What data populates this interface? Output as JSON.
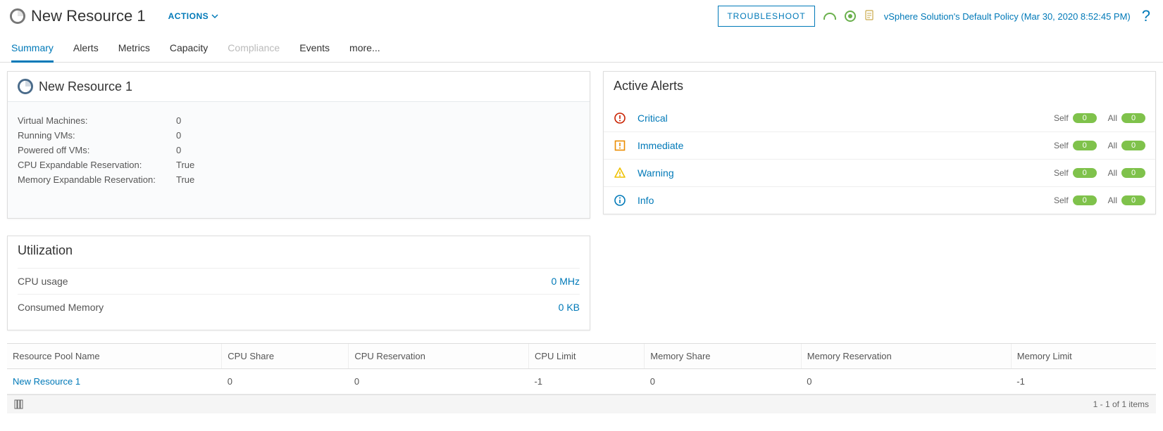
{
  "header": {
    "title": "New Resource 1",
    "actions_label": "ACTIONS",
    "troubleshoot_label": "TROUBLESHOOT",
    "policy_text": "vSphere Solution's Default Policy (Mar 30, 2020 8:52:45 PM)"
  },
  "tabs": [
    {
      "label": "Summary",
      "active": true,
      "disabled": false
    },
    {
      "label": "Alerts",
      "active": false,
      "disabled": false
    },
    {
      "label": "Metrics",
      "active": false,
      "disabled": false
    },
    {
      "label": "Capacity",
      "active": false,
      "disabled": false
    },
    {
      "label": "Compliance",
      "active": false,
      "disabled": true
    },
    {
      "label": "Events",
      "active": false,
      "disabled": false
    },
    {
      "label": "more...",
      "active": false,
      "disabled": false
    }
  ],
  "summary_card": {
    "title": "New Resource 1",
    "rows": [
      {
        "label": "Virtual Machines:",
        "value": "0"
      },
      {
        "label": "Running VMs:",
        "value": "0"
      },
      {
        "label": "Powered off VMs:",
        "value": "0"
      },
      {
        "label": "CPU Expandable Reservation:",
        "value": "True"
      },
      {
        "label": "Memory Expandable Reservation:",
        "value": "True"
      }
    ]
  },
  "utilization": {
    "title": "Utilization",
    "rows": [
      {
        "label": "CPU usage",
        "value": "0 MHz"
      },
      {
        "label": "Consumed Memory",
        "value": "0 KB"
      }
    ]
  },
  "alerts": {
    "title": "Active Alerts",
    "self_label": "Self",
    "all_label": "All",
    "rows": [
      {
        "level": "Critical",
        "self": "0",
        "all": "0",
        "color": "#c92100",
        "shape": "circle-excl"
      },
      {
        "level": "Immediate",
        "self": "0",
        "all": "0",
        "color": "#eb8d00",
        "shape": "square-excl"
      },
      {
        "level": "Warning",
        "self": "0",
        "all": "0",
        "color": "#efc100",
        "shape": "tri-excl"
      },
      {
        "level": "Info",
        "self": "0",
        "all": "0",
        "color": "#0079b8",
        "shape": "circle-i"
      }
    ]
  },
  "grid": {
    "columns": [
      "Resource Pool Name",
      "CPU Share",
      "CPU Reservation",
      "CPU Limit",
      "Memory Share",
      "Memory Reservation",
      "Memory Limit"
    ],
    "rows": [
      {
        "name": "New Resource 1",
        "cpu_share": "0",
        "cpu_res": "0",
        "cpu_limit": "-1",
        "mem_share": "0",
        "mem_res": "0",
        "mem_limit": "-1"
      }
    ],
    "footer_text": "1 - 1 of 1 items"
  }
}
